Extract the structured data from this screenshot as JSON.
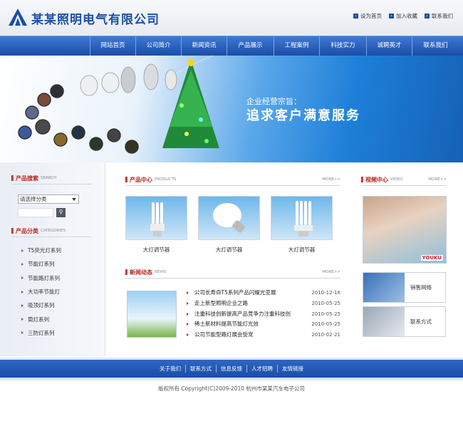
{
  "header": {
    "logo_text": "某某照明电气有限公司",
    "toplinks": [
      "设为首页",
      "加入收藏",
      "联系我们"
    ]
  },
  "nav": {
    "items": [
      "网站首页",
      "公司简介",
      "新闻资讯",
      "产品展示",
      "工程案例",
      "科技实力",
      "诚聘英才",
      "联系我们"
    ]
  },
  "banner": {
    "line1": "企业经营宗旨：",
    "line2": "追求客户满意服务"
  },
  "sidebar": {
    "search_title": "产品搜索",
    "search_sub": "SEARCH",
    "select_value": "请选择分类",
    "category_title": "产品分类",
    "category_sub": "CATEGORIES",
    "categories": [
      "T5荧光灯系列",
      "节能灯系列",
      "节能路灯系列",
      "大功率节能灯",
      "吸顶灯系列",
      "筒灯系列",
      "三防灯系列"
    ]
  },
  "products": {
    "title": "产品中心",
    "sub": "PRODUCTS",
    "more": "MORE>>",
    "items": [
      {
        "caption": "大灯调节器"
      },
      {
        "caption": "大灯调节器"
      },
      {
        "caption": "大灯调节器"
      }
    ]
  },
  "news": {
    "title": "新闻动态",
    "sub": "NEWS",
    "more": "MORE>>",
    "items": [
      {
        "title": "公司长寿命T5系列产品闪耀光亚展",
        "date": "2010-12-16"
      },
      {
        "title": "走上新型照明企业之路",
        "date": "2010-05-25"
      },
      {
        "title": "注重科技创新提高产品竞争力注重科技创",
        "date": "2010-05-25"
      },
      {
        "title": "稀土新材料提高节能灯光效",
        "date": "2010-05-25"
      },
      {
        "title": "公司节能型路灯展会受宠",
        "date": "2010-02-21"
      }
    ]
  },
  "video": {
    "title": "视频中心",
    "sub": "VIDEO",
    "more": "MORE>>",
    "badge": "YOUKU"
  },
  "services": [
    "销售网络",
    "联系方式"
  ],
  "footer": {
    "links": [
      "关于我们",
      "联系方式",
      "信息反馈",
      "人才招聘",
      "友情链接"
    ],
    "copyright": "版权所有  Copyright(C)2009-2010 杭州市某某汽车电子公司"
  },
  "colors": {
    "brand": "#1b4fa7",
    "accent": "#b3261e",
    "nav": "#2a62c0"
  }
}
